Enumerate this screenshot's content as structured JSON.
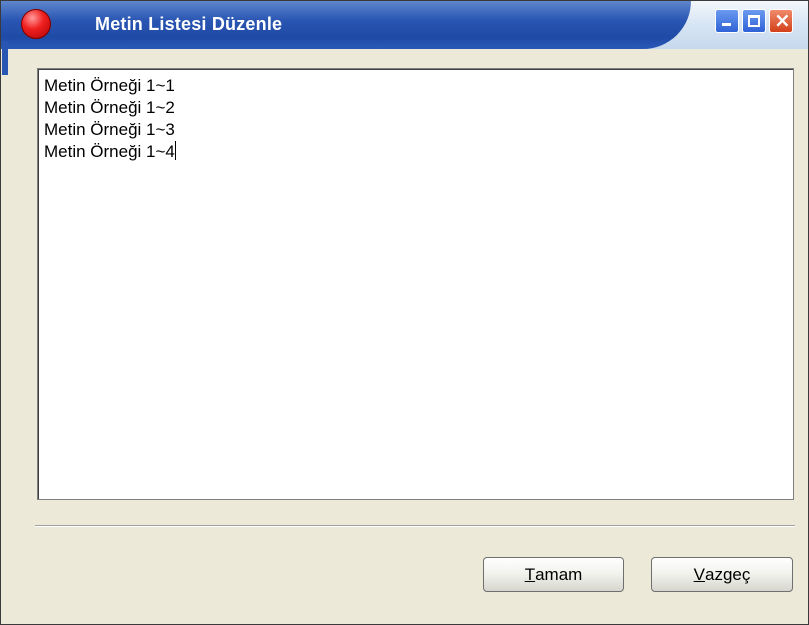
{
  "window": {
    "title": "Metin Listesi Düzenle",
    "controls": {
      "minimize": "_",
      "maximize": "□",
      "close": "×"
    }
  },
  "editor": {
    "lines": [
      "Metin Örneği 1~1",
      "Metin Örneği 1~2",
      "Metin Örneği 1~3",
      "Metin Örneği 1~4"
    ]
  },
  "buttons": {
    "ok": {
      "mnemonic": "T",
      "rest": "amam"
    },
    "cancel": {
      "mnemonic": "V",
      "rest": "azgeç"
    }
  },
  "colors": {
    "titlebar_accent": "#2a56b3",
    "close_button": "#d2401a",
    "window_bg": "#ece9d8"
  }
}
